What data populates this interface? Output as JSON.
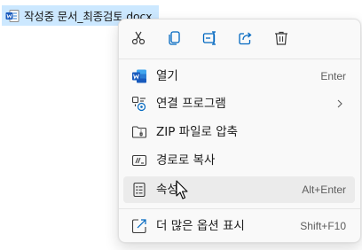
{
  "file": {
    "name": "작성중 문서_최종검토.docx",
    "icon": "word-doc-icon"
  },
  "quick_actions": [
    {
      "name": "cut",
      "icon": "scissors-icon"
    },
    {
      "name": "copy",
      "icon": "copy-icon"
    },
    {
      "name": "rename",
      "icon": "rename-icon"
    },
    {
      "name": "share",
      "icon": "share-icon"
    },
    {
      "name": "delete",
      "icon": "trash-icon"
    }
  ],
  "menu": {
    "items": [
      {
        "label": "열기",
        "shortcut": "Enter",
        "icon": "word-icon"
      },
      {
        "label": "연결 프로그램",
        "shortcut": "",
        "icon": "open-with-icon",
        "has_submenu": true
      },
      {
        "label": "ZIP 파일로 압축",
        "shortcut": "",
        "icon": "zip-folder-icon"
      },
      {
        "label": "경로로 복사",
        "shortcut": "",
        "icon": "copy-path-icon"
      },
      {
        "label": "속성",
        "shortcut": "Alt+Enter",
        "icon": "properties-icon",
        "highlighted": true
      },
      {
        "label": "더 많은 옵션 표시",
        "shortcut": "Shift+F10",
        "icon": "more-options-icon"
      }
    ]
  },
  "colors": {
    "accent": "#0067c0",
    "word_blue": "#185abd",
    "selection": "#cce8ff",
    "hover": "#ebebeb"
  }
}
